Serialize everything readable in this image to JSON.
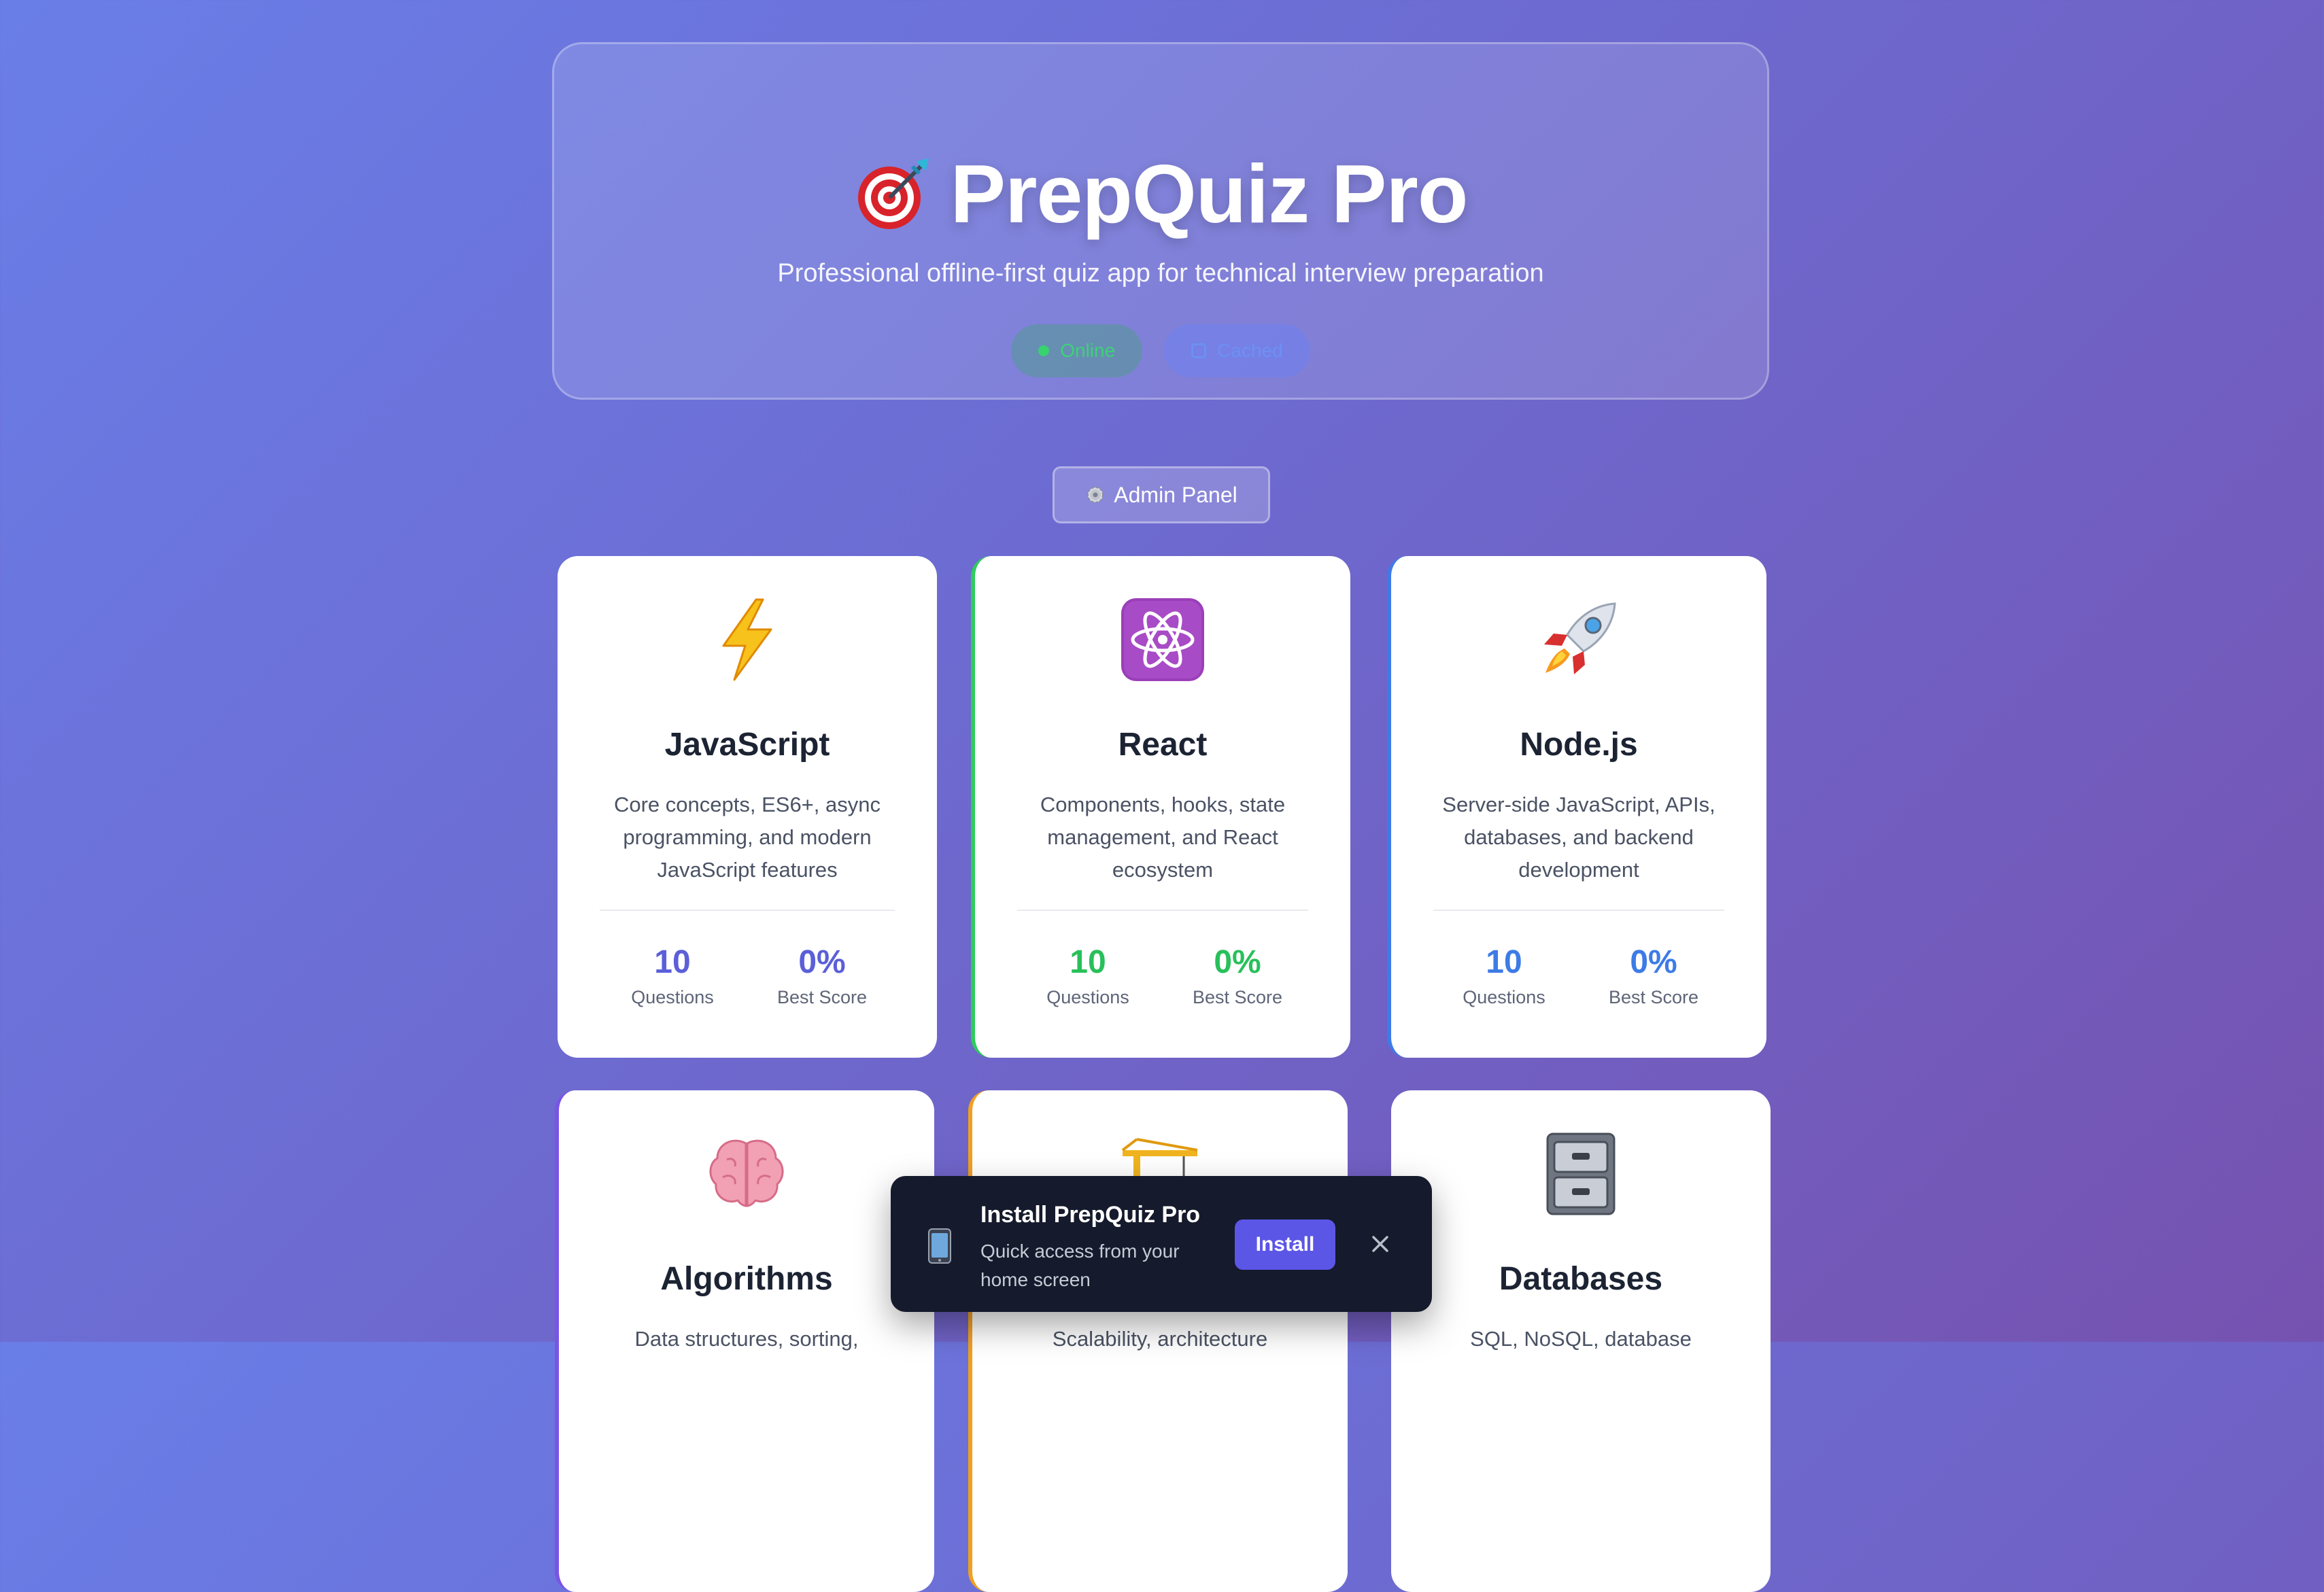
{
  "header": {
    "title": "PrepQuiz Pro",
    "title_icon": "dart-target-icon",
    "subtitle": "Professional offline-first quiz app for technical interview preparation",
    "status_online": "Online",
    "status_cached": "Cached"
  },
  "admin": {
    "label": "Admin Panel",
    "icon": "gear-icon"
  },
  "categories": [
    {
      "title": "JavaScript",
      "icon": "lightning-icon",
      "description": "Core concepts, ES6+, async programming, and modern JavaScript features",
      "questions": "10",
      "questions_label": "Questions",
      "best_score": "0%",
      "best_score_label": "Best Score",
      "accent": "#5b5fd8"
    },
    {
      "title": "React",
      "icon": "atom-icon",
      "description": "Components, hooks, state management, and React ecosystem",
      "questions": "10",
      "questions_label": "Questions",
      "best_score": "0%",
      "best_score_label": "Best Score",
      "accent": "#28c05a"
    },
    {
      "title": "Node.js",
      "icon": "rocket-icon",
      "description": "Server-side JavaScript, APIs, databases, and backend development",
      "questions": "10",
      "questions_label": "Questions",
      "best_score": "0%",
      "best_score_label": "Best Score",
      "accent": "#3d7be6"
    },
    {
      "title": "Algorithms",
      "icon": "brain-icon",
      "description": "Data structures, sorting,",
      "accent": "#7a54e6"
    },
    {
      "title": "",
      "icon": "crane-icon",
      "description": "Scalability, architecture",
      "accent": "#f0a020"
    },
    {
      "title": "Databases",
      "icon": "file-cabinet-icon",
      "description": "SQL, NoSQL, database",
      "accent": "#7a54e6"
    }
  ],
  "install": {
    "title": "Install PrepQuiz Pro",
    "subtitle": "Quick access from your home screen",
    "button": "Install",
    "icon": "phone-icon"
  },
  "colors": {
    "background_start": "#6a7ee8",
    "background_end": "#7652b0",
    "online": "#37d36f",
    "cached": "#6c90f4",
    "install_button": "#5b56e6"
  }
}
